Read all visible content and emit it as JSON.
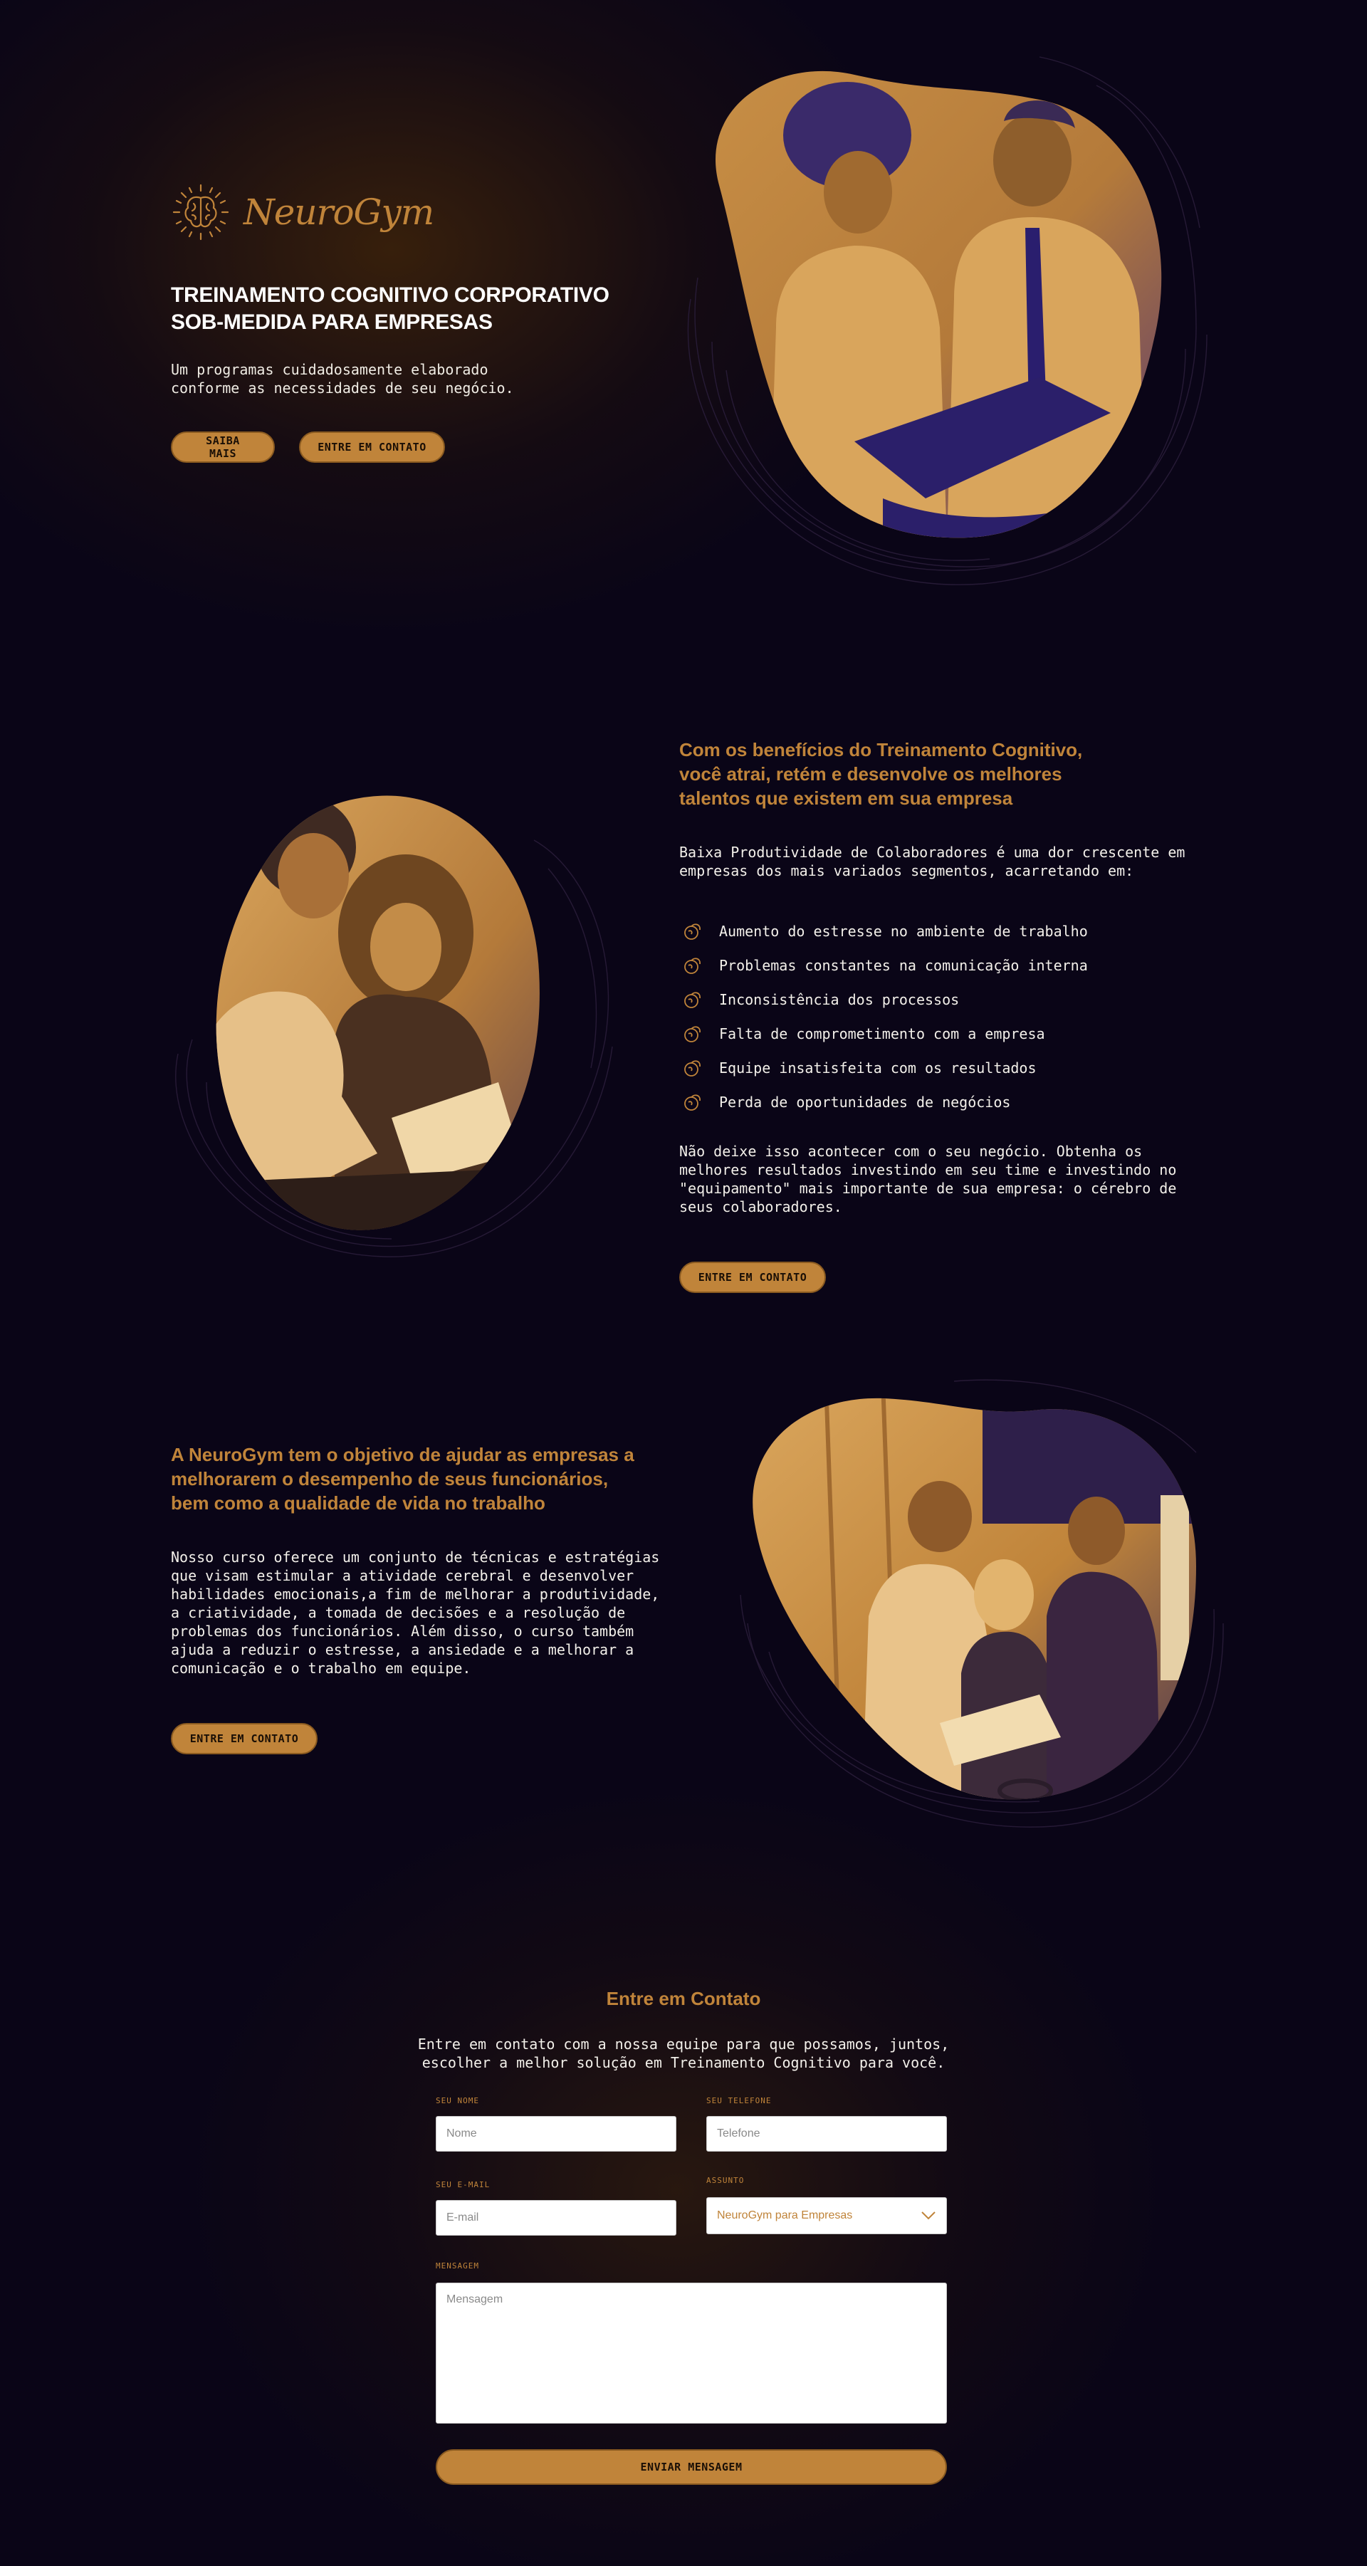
{
  "colors": {
    "background": "#0a0517",
    "accent": "#c0843a",
    "text": "#f3f0ea"
  },
  "hero": {
    "logo_text": "NeuroGym",
    "logo_icon": "brain-icon",
    "title_line1": "TREINAMENTO COGNITIVO CORPORATIVO",
    "title_line2": "SOB-MEDIDA PARA EMPRESAS",
    "subtitle_line1": "Um programas cuidadosamente elaborado",
    "subtitle_line2": "conforme as necessidades de seu negócio.",
    "btn_saiba": "SAIBA MAIS",
    "btn_contato": "ENTRE EM CONTATO"
  },
  "benefits": {
    "heading_line1": "Com os benefícios do Treinamento Cognitivo,",
    "heading_line2": "você atrai, retém e desenvolve os melhores",
    "heading_line3": "talentos que existem em sua empresa",
    "intro_line1": "Baixa Produtividade de Colaboradores é uma dor crescente em",
    "intro_line2": "empresas dos mais variados segmentos, acarretando em:",
    "items": [
      "Aumento do estresse no ambiente de trabalho",
      "Problemas constantes na comunicação interna",
      "Inconsistência dos processos",
      "Falta de comprometimento com a empresa",
      "Equipe insatisfeita com os resultados",
      "Perda de oportunidades de negócios"
    ],
    "closing_line1": "Não deixe isso acontecer com o seu negócio. Obtenha os",
    "closing_line2": "melhores resultados investindo em seu time e investindo no",
    "closing_line3": "\"equipamento\" mais importante de sua empresa: o cérebro de",
    "closing_line4": "seus colaboradores.",
    "cta": "ENTRE EM CONTATO"
  },
  "about": {
    "heading_line1": "A NeuroGym tem o objetivo de ajudar as empresas a",
    "heading_line2": "melhorarem o desempenho de seus funcionários,",
    "heading_line3": "bem como a qualidade de vida no trabalho",
    "body_lines": [
      "Nosso curso oferece um conjunto de técnicas e estratégias",
      "que visam estimular a atividade cerebral e desenvolver",
      "habilidades emocionais,a fim de melhorar a produtividade,",
      "a criatividade, a tomada de decisões e a resolução de",
      "problemas dos funcionários. Além disso, o curso também",
      "ajuda a reduzir o estresse, a ansiedade e a melhorar a",
      "comunicação e o trabalho em equipe."
    ],
    "cta": "ENTRE EM CONTATO"
  },
  "contact": {
    "title": "Entre em Contato",
    "sub_line1": "Entre em contato com a nossa equipe para que possamos, juntos,",
    "sub_line2": "escolher a melhor solução em Treinamento Cognitivo para você.",
    "name_label": "SEU NOME",
    "name_placeholder": "Nome",
    "phone_label": "SEU TELEFONE",
    "phone_placeholder": "Telefone",
    "email_label": "SEU E-MAIL",
    "email_placeholder": "E-mail",
    "subject_label": "ASSUNTO",
    "subject_value": "NeuroGym para Empresas",
    "message_label": "MENSAGEM",
    "message_placeholder": "Mensagem",
    "submit": "ENVIAR MENSAGEM"
  }
}
